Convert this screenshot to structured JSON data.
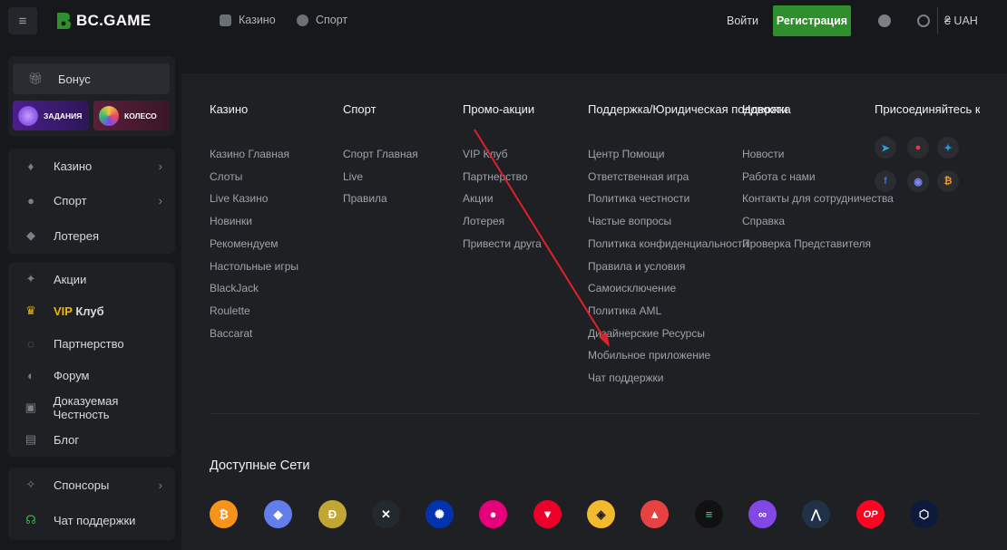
{
  "header": {
    "logo_text": "BC.GAME",
    "nav": [
      {
        "label": "Казино",
        "icon": "casino-icon"
      },
      {
        "label": "Спорт",
        "icon": "sport-icon"
      }
    ],
    "login_label": "Войти",
    "register_label": "Регистрация",
    "currency": "₴ UAH",
    "accent": "#2f8f2c"
  },
  "sidebar": {
    "bonus_label": "Бонус",
    "promo_tasks": "ЗАДАНИЯ",
    "promo_wheel": "КОЛЕСО",
    "items": [
      {
        "label": "Казино",
        "icon": "casino-icon"
      },
      {
        "label": "Спорт",
        "icon": "sport-icon"
      },
      {
        "label": "Лотерея",
        "icon": "lottery-icon"
      },
      {
        "label": "Акции",
        "icon": "promo-icon"
      },
      {
        "label_prefix": "VIP",
        "label": "Клуб",
        "icon": "vip-crown-icon"
      },
      {
        "label": "Партнерство",
        "icon": "partner-icon"
      },
      {
        "label": "Форум",
        "icon": "forum-icon"
      },
      {
        "label": "Доказуемая Честность",
        "icon": "fairness-icon"
      },
      {
        "label": "Блог",
        "icon": "blog-icon"
      },
      {
        "label": "Спонсоры",
        "icon": "sponsors-icon"
      },
      {
        "label": "Чат поддержки",
        "icon": "headset-icon"
      }
    ]
  },
  "footer": {
    "columns": [
      {
        "title": "Казино",
        "links": [
          "Казино Главная",
          "Слоты",
          "Live Казино",
          "Новинки",
          "Рекомендуем",
          "Настольные игры",
          "BlackJack",
          "Roulette",
          "Baccarat"
        ]
      },
      {
        "title": "Спорт",
        "links": [
          "Спорт Главная",
          "Live",
          "Правила"
        ]
      },
      {
        "title": "Промо-акции",
        "links": [
          "VIP Клуб",
          "Партнерство",
          "Акции",
          "Лотерея",
          "Привести друга"
        ]
      },
      {
        "title": "Поддержка/Юридическая поддержка",
        "links": [
          "Центр Помощи",
          "Ответственная игра",
          "Политика честности",
          "Частые вопросы",
          "Политика конфиденциальности",
          "Правила и условия",
          "Самоисключение",
          "Политика AML",
          "Дизайнерские Ресурсы",
          "Мобильное приложение",
          "Чат поддержки"
        ]
      },
      {
        "title": "Новости",
        "links": [
          "Новости",
          "Работа с нами",
          "Контакты для сотрудничества",
          "Справка",
          "Проверка Представителя"
        ]
      },
      {
        "title": "Присоединяйтесь к нам",
        "links": []
      }
    ],
    "socials": [
      {
        "icon": "telegram-icon",
        "color": "#2aa3df"
      },
      {
        "icon": "github-icon",
        "color": "#e33b3b"
      },
      {
        "icon": "twitter-icon",
        "color": "#1d9bf0"
      },
      {
        "icon": "facebook-icon",
        "color": "#3b6fe0"
      },
      {
        "icon": "discord-icon",
        "color": "#7a86f0"
      },
      {
        "icon": "bitcoin-icon",
        "color": "#f29a1f"
      }
    ],
    "networks_title": "Доступные Сети",
    "networks": [
      {
        "icon": "bitcoin-icon",
        "glyph": "₿",
        "color": "#f7931a"
      },
      {
        "icon": "ethereum-icon",
        "glyph": "◆",
        "color": "#627eea"
      },
      {
        "icon": "dogecoin-icon",
        "glyph": "Ð",
        "color": "#c2a633"
      },
      {
        "icon": "xrp-icon",
        "glyph": "✕",
        "color": "#23292f"
      },
      {
        "icon": "cardano-icon",
        "glyph": "✺",
        "color": "#0033ad"
      },
      {
        "icon": "polkadot-icon",
        "glyph": "●",
        "color": "#e6007a"
      },
      {
        "icon": "tron-icon",
        "glyph": "▼",
        "color": "#eb0029"
      },
      {
        "icon": "bnb-icon",
        "glyph": "◈",
        "color": "#f3ba2f"
      },
      {
        "icon": "avalanche-icon",
        "glyph": "▲",
        "color": "#e84142"
      },
      {
        "icon": "solana-icon",
        "glyph": "≡",
        "color": "#111111"
      },
      {
        "icon": "polygon-icon",
        "glyph": "∞",
        "color": "#8247e5"
      },
      {
        "icon": "arbitrum-icon",
        "glyph": "⋀",
        "color": "#213147"
      },
      {
        "icon": "optimism-icon",
        "glyph": "OP",
        "color": "#ff0420"
      },
      {
        "icon": "cronos-icon",
        "glyph": "⬡",
        "color": "#0e1a3b"
      }
    ]
  }
}
